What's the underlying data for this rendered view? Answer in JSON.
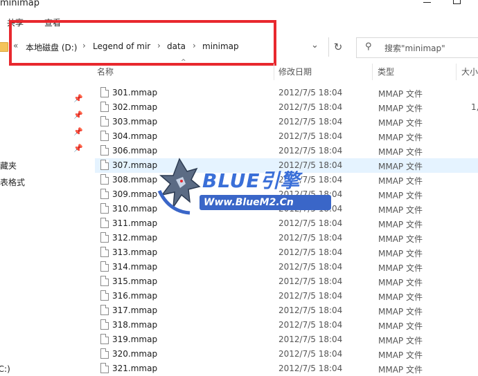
{
  "window": {
    "title": "minimap"
  },
  "ribbon": {
    "tab_share": "共享",
    "tab_view": "查看"
  },
  "address": {
    "crumbs": [
      "本地磁盘 (D:)",
      "Legend of mir",
      "data",
      "minimap"
    ],
    "back_chevrons": "«",
    "separator": "›"
  },
  "search": {
    "placeholder": "搜索\"minimap\""
  },
  "columns": {
    "name": "名称",
    "date": "修改日期",
    "type": "类型",
    "size": "大小"
  },
  "nav": {
    "items": [
      {
        "label": "收藏夹"
      },
      {
        "label": "报表格式"
      },
      {
        "label": "(C:)"
      }
    ]
  },
  "files": [
    {
      "name": "301.mmap",
      "date": "2012/7/5 18:04",
      "type": "MMAP 文件",
      "size": ""
    },
    {
      "name": "302.mmap",
      "date": "2012/7/5 18:04",
      "type": "MMAP 文件",
      "size": "1,"
    },
    {
      "name": "303.mmap",
      "date": "2012/7/5 18:04",
      "type": "MMAP 文件",
      "size": ""
    },
    {
      "name": "304.mmap",
      "date": "2012/7/5 18:04",
      "type": "MMAP 文件",
      "size": ""
    },
    {
      "name": "306.mmap",
      "date": "2012/7/5 18:04",
      "type": "MMAP 文件",
      "size": ""
    },
    {
      "name": "307.mmap",
      "date": "2012/7/5 18:04",
      "type": "MMAP 文件",
      "size": ""
    },
    {
      "name": "308.mmap",
      "date": "2012/7/5 18:04",
      "type": "MMAP 文件",
      "size": ""
    },
    {
      "name": "309.mmap",
      "date": "2012/7/5 18:04",
      "type": "MMAP 文件",
      "size": ""
    },
    {
      "name": "310.mmap",
      "date": "2012/7/5 18:04",
      "type": "MMAP 文件",
      "size": ""
    },
    {
      "name": "311.mmap",
      "date": "2012/7/5 18:04",
      "type": "MMAP 文件",
      "size": ""
    },
    {
      "name": "312.mmap",
      "date": "2012/7/5 18:04",
      "type": "MMAP 文件",
      "size": ""
    },
    {
      "name": "313.mmap",
      "date": "2012/7/5 18:04",
      "type": "MMAP 文件",
      "size": ""
    },
    {
      "name": "314.mmap",
      "date": "2012/7/5 18:04",
      "type": "MMAP 文件",
      "size": ""
    },
    {
      "name": "315.mmap",
      "date": "2012/7/5 18:04",
      "type": "MMAP 文件",
      "size": ""
    },
    {
      "name": "316.mmap",
      "date": "2012/7/5 18:04",
      "type": "MMAP 文件",
      "size": ""
    },
    {
      "name": "317.mmap",
      "date": "2012/7/5 18:04",
      "type": "MMAP 文件",
      "size": ""
    },
    {
      "name": "318.mmap",
      "date": "2012/7/5 18:04",
      "type": "MMAP 文件",
      "size": ""
    },
    {
      "name": "319.mmap",
      "date": "2012/7/5 18:04",
      "type": "MMAP 文件",
      "size": ""
    },
    {
      "name": "320.mmap",
      "date": "2012/7/5 18:04",
      "type": "MMAP 文件",
      "size": ""
    },
    {
      "name": "321.mmap",
      "date": "2012/7/5 18:04",
      "type": "MMAP 文件",
      "size": ""
    }
  ],
  "selected_file_index": 5,
  "watermark": {
    "title": "BLUE引擎",
    "url": "Www.BlueM2.Cn"
  },
  "colors": {
    "highlight": "#e8282e",
    "selected_row": "#e5f3ff",
    "folder": "#f4c35a",
    "watermark_blue": "#3a66c8"
  },
  "icons": [
    "folder-icon",
    "chevron-down-icon",
    "refresh-icon",
    "search-icon",
    "pin-icon",
    "file-icon",
    "minimize-icon",
    "maximize-icon"
  ]
}
